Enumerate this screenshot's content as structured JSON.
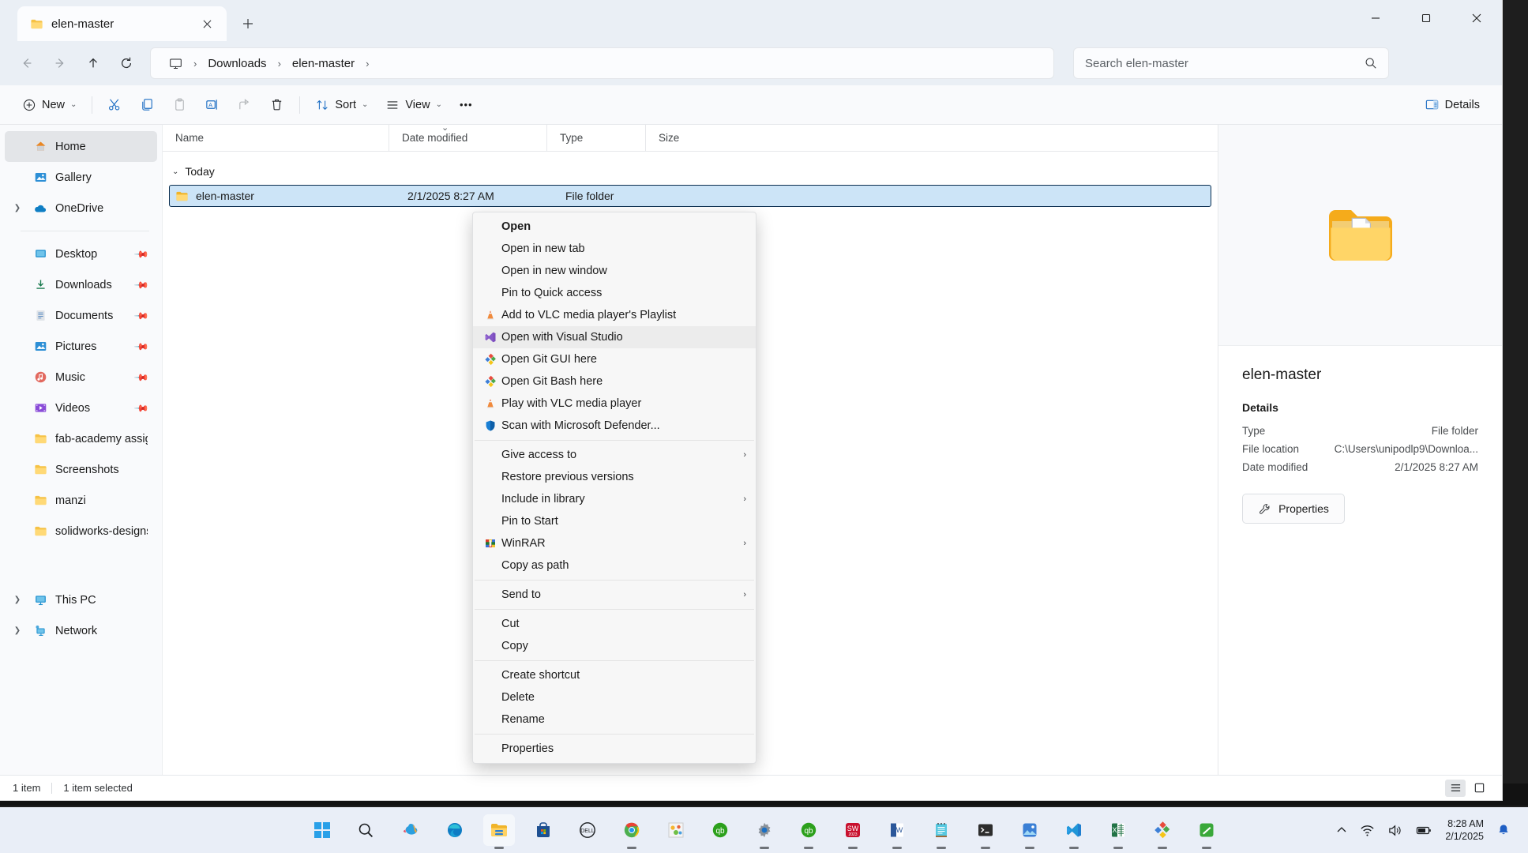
{
  "window": {
    "tab_title": "elen-master",
    "close_tab_icon": "close-icon",
    "new_tab_icon": "plus-icon",
    "controls": {
      "minimize": "minimize-icon",
      "maximize": "maximize-icon",
      "close": "close-icon"
    }
  },
  "nav": {
    "back": "back-arrow-icon",
    "forward": "forward-arrow-icon",
    "up": "up-arrow-icon",
    "refresh": "refresh-icon",
    "breadcrumb_root_icon": "this-pc-icon",
    "breadcrumbs": [
      "Downloads",
      "elen-master"
    ],
    "separator": "›"
  },
  "search": {
    "placeholder": "Search elen-master",
    "icon": "search-icon"
  },
  "toolbar": {
    "new_label": "New",
    "new_icon": "plus-circle-icon",
    "cut_icon": "scissors-icon",
    "copy_icon": "copy-icon",
    "paste_icon": "paste-icon",
    "rename_icon": "rename-icon",
    "share_icon": "share-icon",
    "delete_icon": "trash-icon",
    "sort_label": "Sort",
    "sort_icon": "sort-icon",
    "view_label": "View",
    "view_icon": "view-list-icon",
    "more_label": "•••",
    "details_label": "Details",
    "details_icon": "details-pane-icon"
  },
  "sidebar": {
    "items": [
      {
        "label": "Home",
        "icon": "home-icon",
        "selected": true,
        "expandable": false,
        "pinned": false
      },
      {
        "label": "Gallery",
        "icon": "gallery-icon",
        "selected": false,
        "expandable": false,
        "pinned": false
      },
      {
        "label": "OneDrive",
        "icon": "onedrive-icon",
        "selected": false,
        "expandable": true,
        "pinned": false
      },
      {
        "label": "Desktop",
        "icon": "desktop-icon",
        "selected": false,
        "expandable": false,
        "pinned": true
      },
      {
        "label": "Downloads",
        "icon": "downloads-icon",
        "selected": false,
        "expandable": false,
        "pinned": true
      },
      {
        "label": "Documents",
        "icon": "documents-icon",
        "selected": false,
        "expandable": false,
        "pinned": true
      },
      {
        "label": "Pictures",
        "icon": "pictures-icon",
        "selected": false,
        "expandable": false,
        "pinned": true
      },
      {
        "label": "Music",
        "icon": "music-icon",
        "selected": false,
        "expandable": false,
        "pinned": true
      },
      {
        "label": "Videos",
        "icon": "videos-icon",
        "selected": false,
        "expandable": false,
        "pinned": true
      },
      {
        "label": "fab-academy assign",
        "icon": "folder-icon",
        "selected": false,
        "expandable": false,
        "pinned": false
      },
      {
        "label": "Screenshots",
        "icon": "folder-icon",
        "selected": false,
        "expandable": false,
        "pinned": false
      },
      {
        "label": "manzi",
        "icon": "folder-icon",
        "selected": false,
        "expandable": false,
        "pinned": false
      },
      {
        "label": "solidworks-designs",
        "icon": "folder-icon",
        "selected": false,
        "expandable": false,
        "pinned": false
      }
    ],
    "bottom_items": [
      {
        "label": "This PC",
        "icon": "this-pc-icon",
        "expandable": true
      },
      {
        "label": "Network",
        "icon": "network-icon",
        "expandable": true
      }
    ]
  },
  "filelist": {
    "columns": [
      "Name",
      "Date modified",
      "Type",
      "Size"
    ],
    "sorted_column": "Date modified",
    "group_label": "Today",
    "rows": [
      {
        "name": "elen-master",
        "date_modified": "2/1/2025 8:27 AM",
        "type": "File folder",
        "size": "",
        "icon": "folder-icon",
        "selected": true
      }
    ]
  },
  "details_pane": {
    "preview_icon": "folder-large-icon",
    "title": "elen-master",
    "heading": "Details",
    "fields": [
      {
        "label": "Type",
        "value": "File folder"
      },
      {
        "label": "File location",
        "value": "C:\\Users\\unipodlp9\\Downloa..."
      },
      {
        "label": "Date modified",
        "value": "2/1/2025 8:27 AM"
      }
    ],
    "properties_label": "Properties",
    "properties_icon": "wrench-icon"
  },
  "statusbar": {
    "item_count": "1 item",
    "selection": "1 item selected",
    "view_details_icon": "details-view-icon",
    "view_large_icon": "large-icons-view-icon"
  },
  "context_menu": {
    "items": [
      {
        "label": "Open",
        "icon": null,
        "bold": true,
        "submenu": false,
        "highlighted": false
      },
      {
        "label": "Open in new tab",
        "icon": null,
        "bold": false,
        "submenu": false,
        "highlighted": false
      },
      {
        "label": "Open in new window",
        "icon": null,
        "bold": false,
        "submenu": false,
        "highlighted": false
      },
      {
        "label": "Pin to Quick access",
        "icon": null,
        "bold": false,
        "submenu": false,
        "highlighted": false
      },
      {
        "label": "Add to VLC media player's Playlist",
        "icon": "vlc-icon",
        "bold": false,
        "submenu": false,
        "highlighted": false
      },
      {
        "label": "Open with Visual Studio",
        "icon": "visual-studio-icon",
        "bold": false,
        "submenu": false,
        "highlighted": true
      },
      {
        "label": "Open Git GUI here",
        "icon": "git-icon",
        "bold": false,
        "submenu": false,
        "highlighted": false
      },
      {
        "label": "Open Git Bash here",
        "icon": "git-icon",
        "bold": false,
        "submenu": false,
        "highlighted": false
      },
      {
        "label": "Play with VLC media player",
        "icon": "vlc-icon",
        "bold": false,
        "submenu": false,
        "highlighted": false
      },
      {
        "label": "Scan with Microsoft Defender...",
        "icon": "defender-shield-icon",
        "bold": false,
        "submenu": false,
        "highlighted": false
      },
      {
        "separator": true
      },
      {
        "label": "Give access to",
        "icon": null,
        "bold": false,
        "submenu": true,
        "highlighted": false
      },
      {
        "label": "Restore previous versions",
        "icon": null,
        "bold": false,
        "submenu": false,
        "highlighted": false
      },
      {
        "label": "Include in library",
        "icon": null,
        "bold": false,
        "submenu": true,
        "highlighted": false
      },
      {
        "label": "Pin to Start",
        "icon": null,
        "bold": false,
        "submenu": false,
        "highlighted": false
      },
      {
        "label": "WinRAR",
        "icon": "winrar-icon",
        "bold": false,
        "submenu": true,
        "highlighted": false
      },
      {
        "label": "Copy as path",
        "icon": null,
        "bold": false,
        "submenu": false,
        "highlighted": false
      },
      {
        "separator": true
      },
      {
        "label": "Send to",
        "icon": null,
        "bold": false,
        "submenu": true,
        "highlighted": false
      },
      {
        "separator": true
      },
      {
        "label": "Cut",
        "icon": null,
        "bold": false,
        "submenu": false,
        "highlighted": false
      },
      {
        "label": "Copy",
        "icon": null,
        "bold": false,
        "submenu": false,
        "highlighted": false
      },
      {
        "separator": true
      },
      {
        "label": "Create shortcut",
        "icon": null,
        "bold": false,
        "submenu": false,
        "highlighted": false
      },
      {
        "label": "Delete",
        "icon": null,
        "bold": false,
        "submenu": false,
        "highlighted": false
      },
      {
        "label": "Rename",
        "icon": null,
        "bold": false,
        "submenu": false,
        "highlighted": false
      },
      {
        "separator": true
      },
      {
        "label": "Properties",
        "icon": null,
        "bold": false,
        "submenu": false,
        "highlighted": false
      }
    ],
    "submenu_arrow": "›"
  },
  "taskbar": {
    "apps": [
      {
        "name": "start-button",
        "icon": "windows-logo-icon",
        "running": false,
        "active": false
      },
      {
        "name": "search",
        "icon": "search-icon",
        "running": false,
        "active": false
      },
      {
        "name": "copilot",
        "icon": "copilot-icon",
        "running": false,
        "active": false
      },
      {
        "name": "edge",
        "icon": "edge-icon",
        "running": false,
        "active": false
      },
      {
        "name": "file-explorer",
        "icon": "folder-icon",
        "running": true,
        "active": true
      },
      {
        "name": "microsoft-store",
        "icon": "store-icon",
        "running": false,
        "active": false
      },
      {
        "name": "dell",
        "icon": "dell-icon",
        "running": false,
        "active": false
      },
      {
        "name": "chrome",
        "icon": "chrome-icon",
        "running": true,
        "active": false
      },
      {
        "name": "photos",
        "icon": "photos-icon",
        "running": false,
        "active": false
      },
      {
        "name": "quickbooks",
        "icon": "quickbooks-icon",
        "running": false,
        "active": false
      },
      {
        "name": "settings",
        "icon": "gear-icon",
        "running": true,
        "active": false
      },
      {
        "name": "quickbooks-2",
        "icon": "quickbooks-icon",
        "running": true,
        "active": false
      },
      {
        "name": "solidworks",
        "icon": "solidworks-icon",
        "running": true,
        "active": false
      },
      {
        "name": "word",
        "icon": "word-icon",
        "running": true,
        "active": false
      },
      {
        "name": "notepad",
        "icon": "notepad-icon",
        "running": true,
        "active": false
      },
      {
        "name": "terminal",
        "icon": "terminal-icon",
        "running": true,
        "active": false
      },
      {
        "name": "photos-2",
        "icon": "photos-icon",
        "running": true,
        "active": false
      },
      {
        "name": "vscode",
        "icon": "vscode-icon",
        "running": true,
        "active": false
      },
      {
        "name": "excel",
        "icon": "excel-icon",
        "running": true,
        "active": false
      },
      {
        "name": "git",
        "icon": "git-icon",
        "running": true,
        "active": false
      },
      {
        "name": "kicad",
        "icon": "kicad-icon",
        "running": true,
        "active": false
      }
    ],
    "tray": {
      "show_hidden_icon": "chevron-up-icon",
      "wifi_icon": "wifi-icon",
      "volume_icon": "speaker-icon",
      "battery_icon": "battery-icon",
      "time": "8:28 AM",
      "date": "2/1/2025",
      "notification_icon": "bell-icon"
    }
  }
}
